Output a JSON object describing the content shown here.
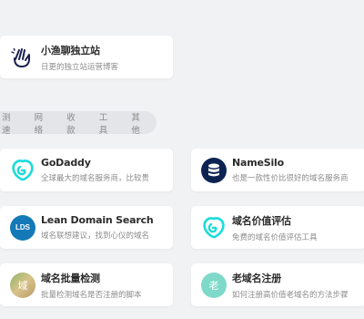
{
  "featured": {
    "title": "小渔聊独立站",
    "desc": "日更的独立站运营博客",
    "icon": "hand-logo-icon"
  },
  "tabs": [
    "测速",
    "网络",
    "收款",
    "工具",
    "其他"
  ],
  "cards": [
    {
      "title": "GoDaddy",
      "desc": "全球最大的域名服务商，比较贵",
      "icon": "godaddy-logo-icon"
    },
    {
      "title": "NameSilo",
      "desc": "也是一款性价比很好的域名服务商",
      "icon": "namesilo-logo-icon"
    },
    {
      "title": "Lean Domain Search",
      "desc": "域名联想建议，找到心仪的域名",
      "icon": "lds-logo-icon",
      "badge": "LDS"
    },
    {
      "title": "域名价值评估",
      "desc": "免费的域名价值评估工具",
      "icon": "domain-value-logo-icon"
    },
    {
      "title": "域名批量检测",
      "desc": "批量检测域名是否注册的脚本",
      "icon": "batch-check-logo-icon",
      "badge": "域"
    },
    {
      "title": "老域名注册",
      "desc": "如何注册高价值老域名的方法步骤",
      "icon": "old-domain-logo-icon",
      "badge": "老"
    }
  ],
  "colors": {
    "godaddy": "#1bdbdb",
    "namesilo": "#0d2452",
    "lds": "#1479b7",
    "batch": "#c9b27a",
    "old": "#7ed9c9"
  }
}
